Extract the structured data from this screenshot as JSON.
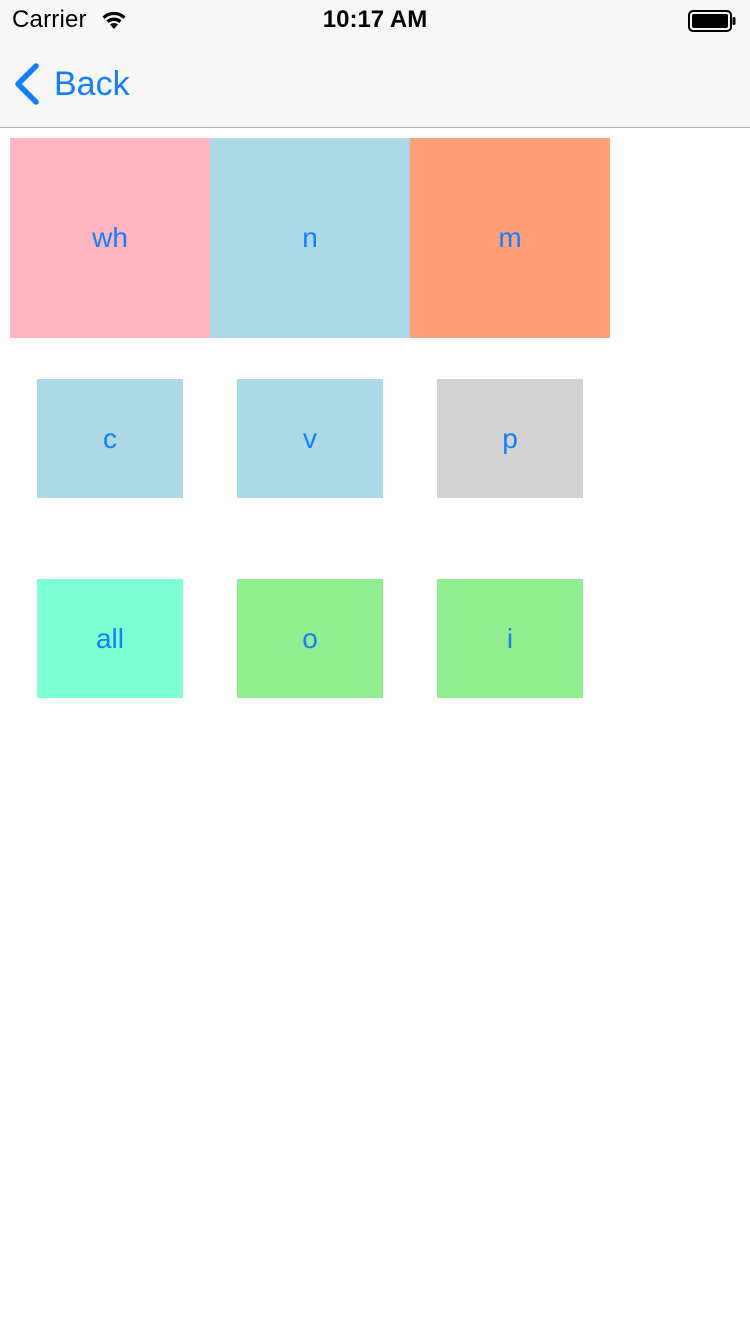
{
  "status_bar": {
    "carrier": "Carrier",
    "time": "10:17 AM",
    "wifi_icon": "wifi-icon",
    "battery_icon": "battery-icon"
  },
  "nav": {
    "back_label": "Back",
    "back_icon": "chevron-left-icon",
    "tint_color": "#147efb"
  },
  "tiles": {
    "row1": [
      {
        "label": "wh",
        "color": "#ffb6c1"
      },
      {
        "label": "n",
        "color": "#add8e6"
      },
      {
        "label": "m",
        "color": "#ffa07a"
      }
    ],
    "row2": [
      {
        "label": "c",
        "color": "#add8e6"
      },
      {
        "label": "v",
        "color": "#add8e6"
      },
      {
        "label": "p",
        "color": "#d3d3d3"
      }
    ],
    "row3": [
      {
        "label": "all",
        "color": "#7fffd4"
      },
      {
        "label": "o",
        "color": "#90ee90"
      },
      {
        "label": "i",
        "color": "#90ee90"
      }
    ]
  }
}
